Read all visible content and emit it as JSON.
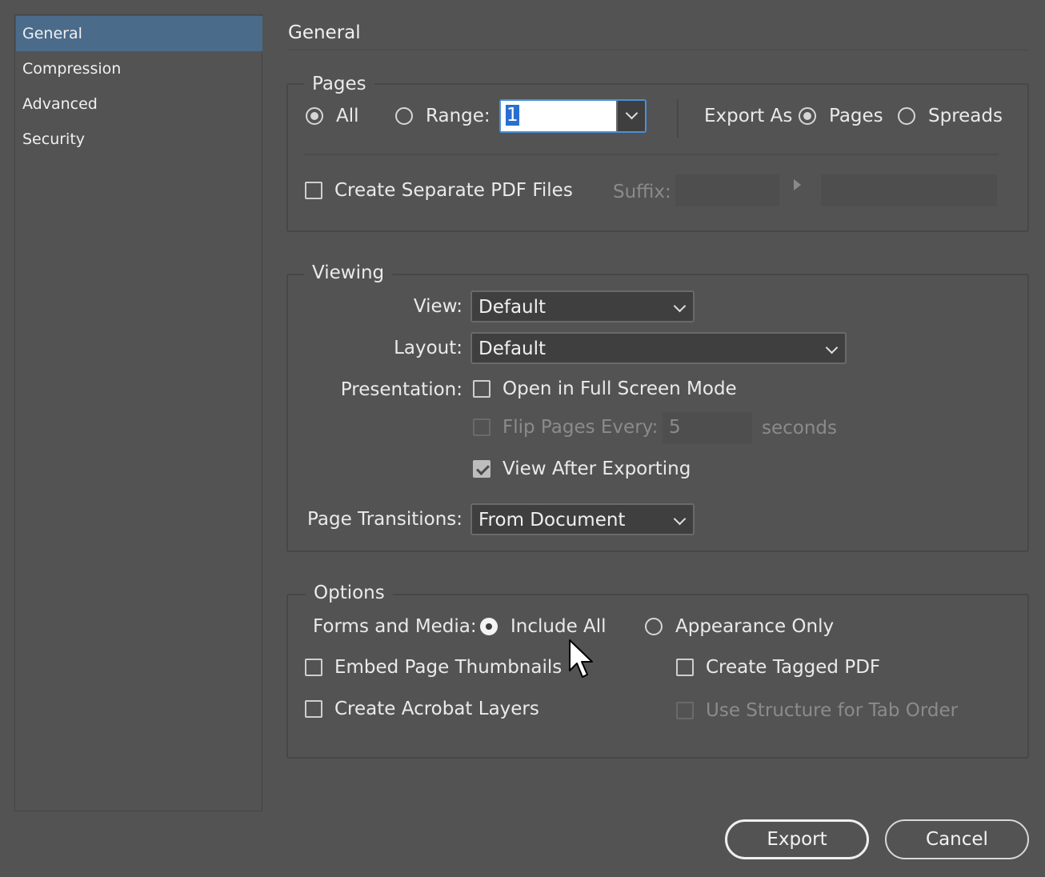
{
  "sidebar": {
    "items": [
      {
        "label": "General",
        "selected": true
      },
      {
        "label": "Compression"
      },
      {
        "label": "Advanced"
      },
      {
        "label": "Security"
      }
    ]
  },
  "page_title": "General",
  "pages": {
    "legend": "Pages",
    "all_label": "All",
    "range_label": "Range:",
    "range_value": "1",
    "export_as_label": "Export As",
    "pages_label": "Pages",
    "spreads_label": "Spreads",
    "separate_label": "Create Separate PDF Files",
    "suffix_label": "Suffix:"
  },
  "viewing": {
    "legend": "Viewing",
    "view_label": "View:",
    "view_value": "Default",
    "layout_label": "Layout:",
    "layout_value": "Default",
    "presentation_label": "Presentation:",
    "fullscreen_label": "Open in Full Screen Mode",
    "flip_label": "Flip Pages Every:",
    "flip_value": "5",
    "seconds_label": "seconds",
    "view_after_label": "View After Exporting",
    "transitions_label": "Page Transitions:",
    "transitions_value": "From Document"
  },
  "options": {
    "legend": "Options",
    "forms_label": "Forms and Media:",
    "include_all_label": "Include All",
    "appearance_label": "Appearance Only",
    "thumbnails_label": "Embed Page Thumbnails",
    "tagged_label": "Create Tagged PDF",
    "layers_label": "Create Acrobat Layers",
    "tab_order_label": "Use Structure for Tab Order"
  },
  "buttons": {
    "export": "Export",
    "cancel": "Cancel"
  },
  "colors": {
    "background": "#535353",
    "selection": "#4b6b8b",
    "focus": "#4a90d9"
  }
}
